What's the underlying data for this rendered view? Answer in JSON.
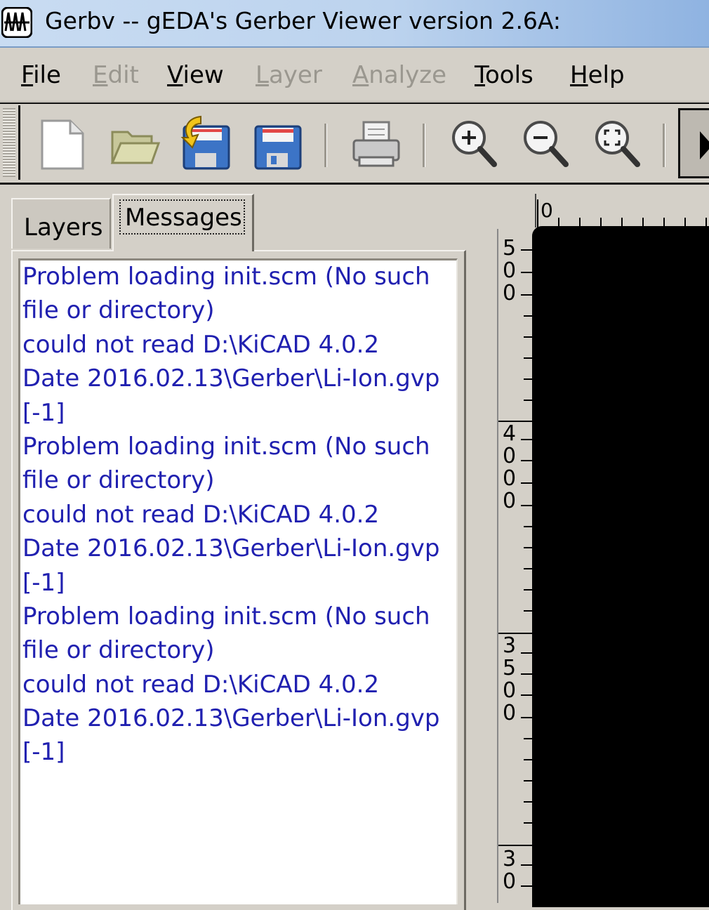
{
  "window": {
    "title": "Gerbv -- gEDA's Gerber Viewer version 2.6A:",
    "icon": "gerbv-app-icon"
  },
  "menubar": {
    "items": [
      {
        "accel": "F",
        "rest": "ile",
        "enabled": true
      },
      {
        "accel": "E",
        "rest": "dit",
        "enabled": false
      },
      {
        "accel": "V",
        "rest": "iew",
        "enabled": true
      },
      {
        "accel": "L",
        "rest": "ayer",
        "enabled": false
      },
      {
        "accel": "A",
        "rest": "nalyze",
        "enabled": false
      },
      {
        "accel": "T",
        "rest": "ools",
        "enabled": true
      },
      {
        "accel": "H",
        "rest": "elp",
        "enabled": true
      }
    ]
  },
  "toolbar": {
    "buttons": [
      "new-project-icon",
      "open-folder-icon",
      "revert-icon",
      "save-icon",
      "print-icon",
      "zoom-in-icon",
      "zoom-out-icon",
      "zoom-fit-icon"
    ]
  },
  "sidebar": {
    "tabs": [
      {
        "label": "Layers",
        "active": false
      },
      {
        "label": "Messages",
        "active": true
      }
    ]
  },
  "messages": {
    "color": "#2020b0",
    "lines": [
      "Problem loading init.scm (No such",
      "file or directory)",
      "could not read D:\\KiCAD 4.0.2",
      "Date 2016.02.13\\Gerber\\Li-Ion.gvp",
      "[-1]",
      "Problem loading init.scm (No such",
      "file or directory)",
      "could not read D:\\KiCAD 4.0.2",
      "Date 2016.02.13\\Gerber\\Li-Ion.gvp",
      "[-1]",
      "Problem loading init.scm (No such",
      "file or directory)",
      "could not read D:\\KiCAD 4.0.2",
      "Date 2016.02.13\\Gerber\\Li-Ion.gvp",
      "[-1]"
    ]
  },
  "rulers": {
    "horizontal_label": "0",
    "vertical_labels": [
      "500",
      "4000",
      "3500",
      "30"
    ]
  },
  "canvas": {
    "background": "#000000"
  }
}
